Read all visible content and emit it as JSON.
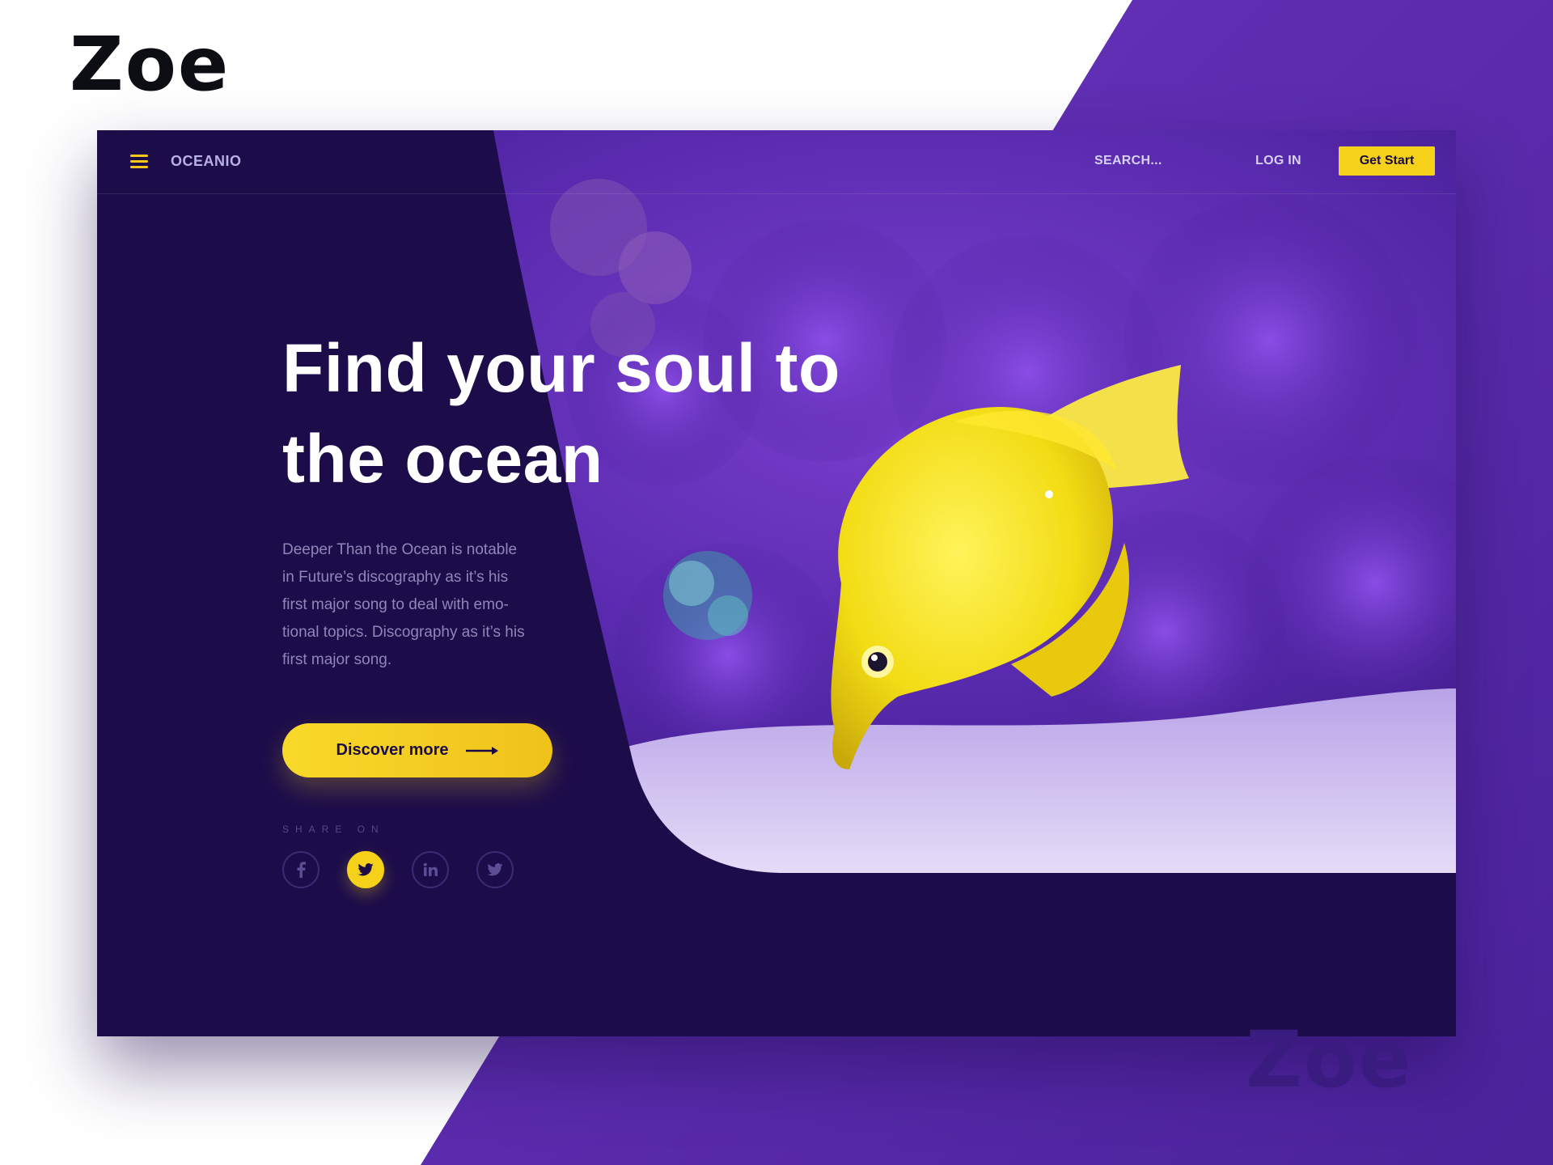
{
  "brand": {
    "logo_text": "Zoe",
    "watermark_text": "Zoe"
  },
  "nav": {
    "menu_icon": "hamburger-menu-icon",
    "brand_name": "OCEANIO",
    "search_placeholder": "SEARCH...",
    "login_label": "LOG IN",
    "cta_label": "Get Start"
  },
  "hero": {
    "headline_line1": "Find your soul to",
    "headline_line2": "the ocean",
    "body_lines": [
      "Deeper Than the Ocean is notable",
      "in Future’s discography as it’s his",
      "first major song to deal with emo-",
      "tional topics. Discography as it’s his",
      "first major song."
    ],
    "discover_label": "Discover more",
    "discover_icon": "arrow-right-icon",
    "image_subject": "yellow-tang-fish-coral-reef"
  },
  "share": {
    "label": "SHARE ON",
    "icons": [
      {
        "name": "facebook-icon",
        "glyph": "f",
        "active": false
      },
      {
        "name": "twitter-icon",
        "glyph": "t",
        "active": true
      },
      {
        "name": "linkedin-icon",
        "glyph": "in",
        "active": false
      },
      {
        "name": "twitter-icon",
        "glyph": "t",
        "active": false
      }
    ]
  },
  "colors": {
    "accent_yellow": "#f5d11a",
    "card_bg": "#1c0c4a",
    "backdrop_purple": "#5a2ea8"
  }
}
